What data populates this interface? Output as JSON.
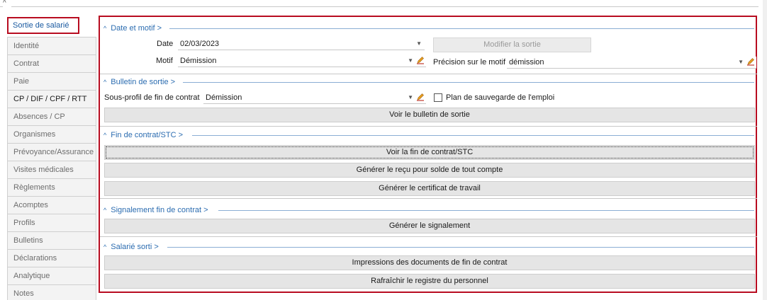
{
  "sidebar": {
    "items": [
      {
        "label": "Sortie de salarié"
      },
      {
        "label": "Identité"
      },
      {
        "label": "Contrat"
      },
      {
        "label": "Paie"
      },
      {
        "label": "CP / DIF / CPF / RTT"
      },
      {
        "label": "Absences / CP"
      },
      {
        "label": "Organismes"
      },
      {
        "label": "Prévoyance/Assurance"
      },
      {
        "label": "Visites médicales"
      },
      {
        "label": "Règlements"
      },
      {
        "label": "Acomptes"
      },
      {
        "label": "Profils"
      },
      {
        "label": "Bulletins"
      },
      {
        "label": "Déclarations"
      },
      {
        "label": "Analytique"
      },
      {
        "label": "Notes"
      }
    ]
  },
  "sections": {
    "date_motif": {
      "title": "Date et motif >",
      "date_label": "Date",
      "date_value": "02/03/2023",
      "modify_button": "Modifier la sortie",
      "motif_label": "Motif",
      "motif_value": "Démission",
      "precision_label": "Précision sur le motif",
      "precision_value": "démission"
    },
    "bulletin": {
      "title": "Bulletin de sortie >",
      "subprofile_label": "Sous-profil de fin de contrat",
      "subprofile_value": "Démission",
      "checkbox_label": "Plan de sauvegarde de l'emploi",
      "view_button": "Voir le bulletin de sortie"
    },
    "fin_contrat": {
      "title": "Fin de contrat/STC >",
      "view_button": "Voir la fin de contrat/STC",
      "receipt_button": "Générer le reçu pour solde de tout compte",
      "certificate_button": "Générer le certificat de travail"
    },
    "signalement": {
      "title": "Signalement fin de contrat >",
      "generate_button": "Générer le signalement"
    },
    "salarie_sorti": {
      "title": "Salarié sorti >",
      "print_button": "Impressions des documents de fin de contrat",
      "refresh_button": "Rafraîchir le registre du personnel"
    }
  },
  "colors": {
    "accent_red": "#b80c20",
    "section_blue": "#2b6cb0"
  }
}
